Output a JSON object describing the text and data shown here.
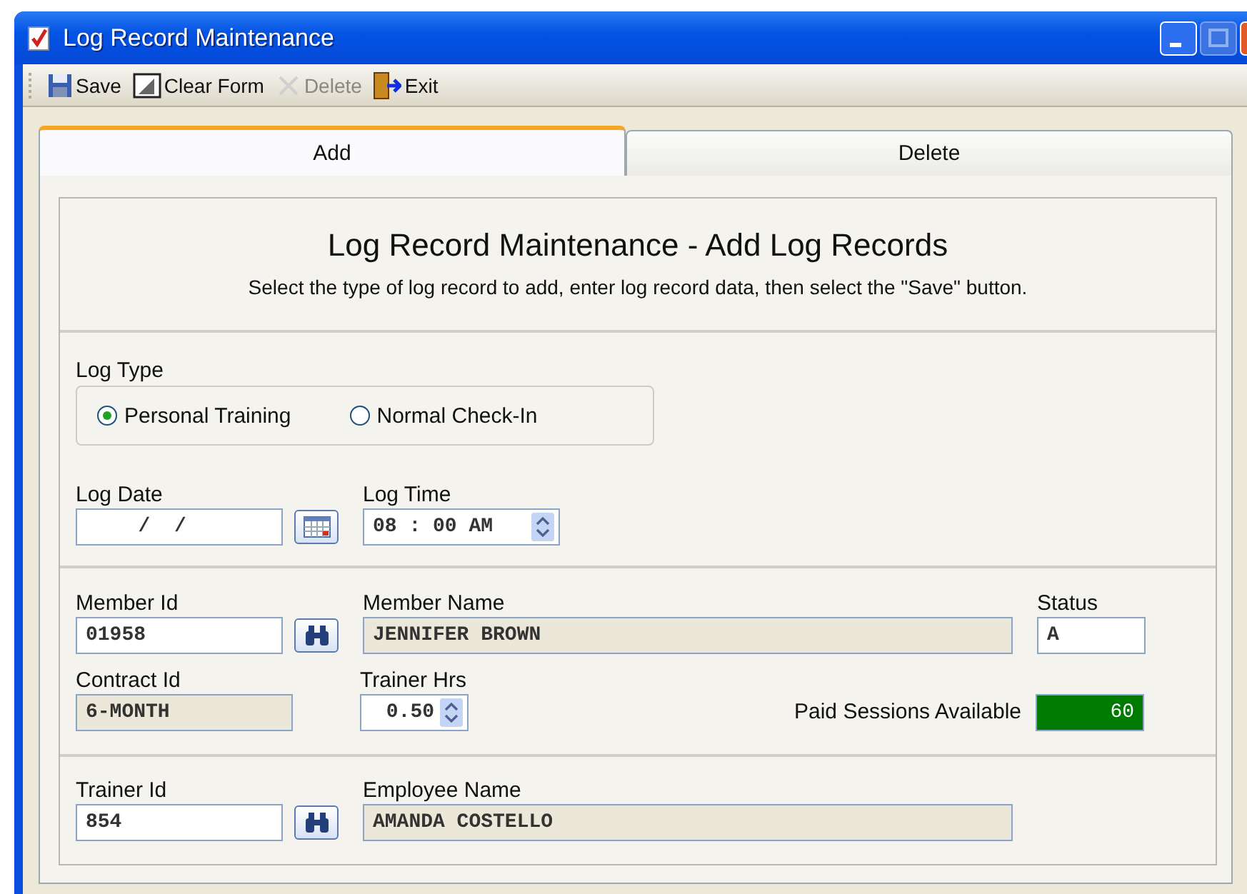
{
  "window": {
    "title": "Log Record Maintenance"
  },
  "toolbar": [
    {
      "label": "Save",
      "kind": "save",
      "disabled": false
    },
    {
      "label": "Clear Form",
      "kind": "clear",
      "disabled": false
    },
    {
      "label": "Delete",
      "kind": "delete",
      "disabled": true
    },
    {
      "label": "Exit",
      "kind": "exit",
      "disabled": false
    }
  ],
  "tabs": [
    {
      "label": "Add",
      "selected": true
    },
    {
      "label": "Delete",
      "selected": false
    }
  ],
  "header": {
    "title": "Log Record Maintenance - Add Log Records",
    "instructions": "Select the type of log record to add, enter log record data, then select the \"Save\" button."
  },
  "log_type": {
    "label": "Log Type",
    "options": [
      {
        "label": "Personal Training",
        "selected": true
      },
      {
        "label": "Normal Check-In",
        "selected": false
      }
    ]
  },
  "log_date": {
    "label": "Log Date",
    "value": "  /  /",
    "readonly": false
  },
  "log_time": {
    "label": "Log Time",
    "value": "08 : 00 AM",
    "readonly": false
  },
  "member_id": {
    "label": "Member Id",
    "value": "01958",
    "readonly": false
  },
  "member_name": {
    "label": "Member Name",
    "value": "JENNIFER BROWN",
    "readonly": true
  },
  "status": {
    "label": "Status",
    "value": "A",
    "readonly": false
  },
  "contract_id": {
    "label": "Contract Id",
    "value": "6-MONTH",
    "readonly": true
  },
  "trainer_hrs": {
    "label": "Trainer Hrs",
    "value": "0.50",
    "readonly": false
  },
  "paid_sessions": {
    "label": "Paid Sessions Available",
    "value": "60",
    "color": "#007a00"
  },
  "trainer_id": {
    "label": "Trainer Id",
    "value": "854",
    "readonly": false
  },
  "employee_name": {
    "label": "Employee Name",
    "value": "AMANDA COSTELLO",
    "readonly": true
  }
}
